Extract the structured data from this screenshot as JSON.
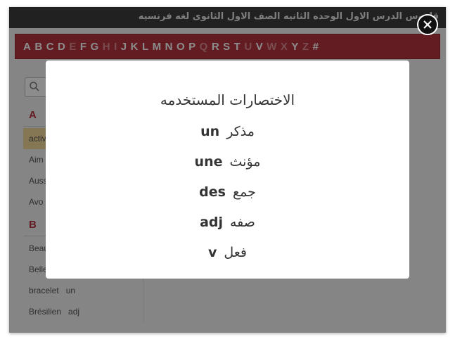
{
  "window": {
    "title": "قاموس الدرس الاول الوحده الثانيه الصف الاول الثانوى لغه فرنسيه"
  },
  "alphabet": {
    "letters": [
      {
        "char": "A",
        "enabled": true
      },
      {
        "char": "B",
        "enabled": true
      },
      {
        "char": "C",
        "enabled": true
      },
      {
        "char": "D",
        "enabled": true
      },
      {
        "char": "E",
        "enabled": false
      },
      {
        "char": "F",
        "enabled": true
      },
      {
        "char": "G",
        "enabled": true
      },
      {
        "char": "H",
        "enabled": false
      },
      {
        "char": "I",
        "enabled": false
      },
      {
        "char": "J",
        "enabled": true
      },
      {
        "char": "K",
        "enabled": true
      },
      {
        "char": "L",
        "enabled": true
      },
      {
        "char": "M",
        "enabled": true
      },
      {
        "char": "N",
        "enabled": true
      },
      {
        "char": "O",
        "enabled": true
      },
      {
        "char": "P",
        "enabled": true
      },
      {
        "char": "Q",
        "enabled": false
      },
      {
        "char": "R",
        "enabled": true
      },
      {
        "char": "S",
        "enabled": true
      },
      {
        "char": "T",
        "enabled": true
      },
      {
        "char": "U",
        "enabled": false
      },
      {
        "char": "V",
        "enabled": true
      },
      {
        "char": "W",
        "enabled": false
      },
      {
        "char": "X",
        "enabled": false
      },
      {
        "char": "Y",
        "enabled": true
      },
      {
        "char": "Z",
        "enabled": false
      },
      {
        "char": "#",
        "enabled": true
      }
    ],
    "colors": {
      "bar": "#b5343e",
      "enabled": "#ffffff",
      "disabled": "#dd8b93"
    }
  },
  "sidebar": {
    "search": {
      "placeholder": "",
      "icon": "search-icon"
    },
    "sections": [
      {
        "letter": "A",
        "words": [
          {
            "word": "activ",
            "abbr": "",
            "selected": true
          },
          {
            "word": "Aim",
            "abbr": ""
          },
          {
            "word": "Auss",
            "abbr": ""
          },
          {
            "word": "Avo",
            "abbr": ""
          }
        ]
      },
      {
        "letter": "B",
        "words": [
          {
            "word": "Beau",
            "abbr": ""
          },
          {
            "word": "Belle",
            "abbr": ""
          },
          {
            "word": "bracelet",
            "abbr": "un"
          },
          {
            "word": "Brésilien",
            "abbr": "adj"
          }
        ]
      }
    ]
  },
  "modal": {
    "title": "الاختصارات المستخدمه",
    "items": [
      {
        "code": "un",
        "meaning": "مذكر"
      },
      {
        "code": "une",
        "meaning": "مؤنث"
      },
      {
        "code": "des",
        "meaning": "جمع"
      },
      {
        "code": "adj",
        "meaning": "صفه"
      },
      {
        "code": "v",
        "meaning": "فعل"
      }
    ],
    "close_icon": "close-icon"
  }
}
